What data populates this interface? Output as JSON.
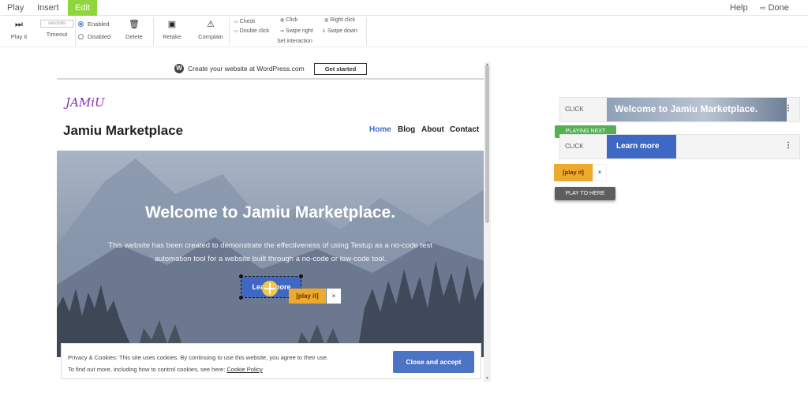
{
  "menu": {
    "play": "Play",
    "insert": "Insert",
    "edit": "Edit",
    "help": "Help",
    "done": "Done",
    "done_icon": "exit-icon"
  },
  "toolbar": {
    "play_it": "Play it",
    "timeout": "Timeout",
    "seconds_placeholder": "seconds",
    "enabled": "Enabled",
    "disabled": "Disabled",
    "delete": "Delete",
    "retake": "Retake",
    "complain": "Complain",
    "check": "Check",
    "click": "Click",
    "right_click": "Right click",
    "double_click": "Double click",
    "swipe_right": "Swipe right",
    "swipe_down": "Swipe down",
    "set_interaction": "Set interaction",
    "enabled_selected": true
  },
  "site": {
    "wp_banner": "Create your website at WordPress.com",
    "wp_button": "Get started",
    "logo": "JAMiU",
    "title": "Jamiu Marketplace",
    "nav": [
      "Home",
      "Blog",
      "About",
      "Contact"
    ],
    "hero_title": "Welcome to Jamiu Marketplace.",
    "hero_desc": "This website has been created to demonstrate the effectiveness of using Testup as a no-code test automation tool for a website built through a no-code or low-code tool.",
    "hero_button": "Learn more",
    "overlay_play": "[play it]",
    "overlay_close": "×",
    "cookie_line1": "Privacy & Cookies: This site uses cookies. By continuing to use this website, you agree to their use.",
    "cookie_line2_prefix": "To find out more, including how to control cookies, see here: ",
    "cookie_link": "Cookie Policy",
    "cookie_button": "Close and accept"
  },
  "steps": [
    {
      "action": "CLICK",
      "thumb_text": "Welcome to Jamiu Marketplace.",
      "menu": "⋮"
    },
    {
      "action": "CLICK",
      "thumb_text": "Learn more",
      "menu": "⋮"
    }
  ],
  "panel": {
    "playing_next": "PLAYING NEXT",
    "play_it": "[play it]",
    "close": "×",
    "play_to_here": "PLAY TO HERE"
  },
  "colors": {
    "edit_tab": "#8ed63c",
    "accent_blue": "#3e68c3",
    "play_tag": "#eeaa2c",
    "playing_next": "#55b052"
  }
}
